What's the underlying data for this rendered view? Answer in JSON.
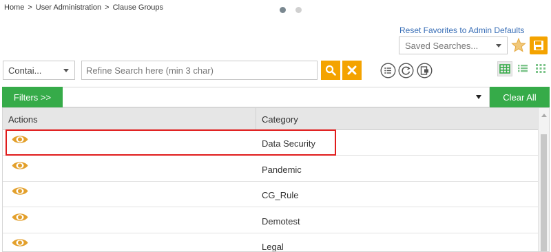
{
  "breadcrumb": {
    "home": "Home",
    "user_admin": "User Administration",
    "clause_groups": "Clause Groups",
    "separator": ">"
  },
  "header": {
    "reset_link": "Reset Favorites to Admin Defaults",
    "saved_searches_placeholder": "Saved Searches..."
  },
  "search": {
    "operator": "Contai...",
    "placeholder": "Refine Search here (min 3 char)",
    "value": ""
  },
  "filters": {
    "filters_label": "Filters >>",
    "clear_all_label": "Clear All"
  },
  "table": {
    "columns": [
      "Actions",
      "Category"
    ],
    "rows": [
      {
        "category": "Data Security"
      },
      {
        "category": "Pandemic"
      },
      {
        "category": "CG_Rule"
      },
      {
        "category": "Demotest"
      },
      {
        "category": "Legal"
      }
    ]
  },
  "colors": {
    "accent_orange": "#f4a300",
    "accent_green": "#36ab49",
    "link_blue": "#3a6fb7",
    "highlight_red": "#e01b1b",
    "eye_icon": "#e3a02c"
  },
  "icons": [
    "star-icon",
    "save-icon",
    "search-icon",
    "close-icon",
    "list-circle-icon",
    "refresh-icon",
    "export-icon",
    "grid-view-icon",
    "list-view-icon",
    "tile-view-icon",
    "eye-icon"
  ]
}
